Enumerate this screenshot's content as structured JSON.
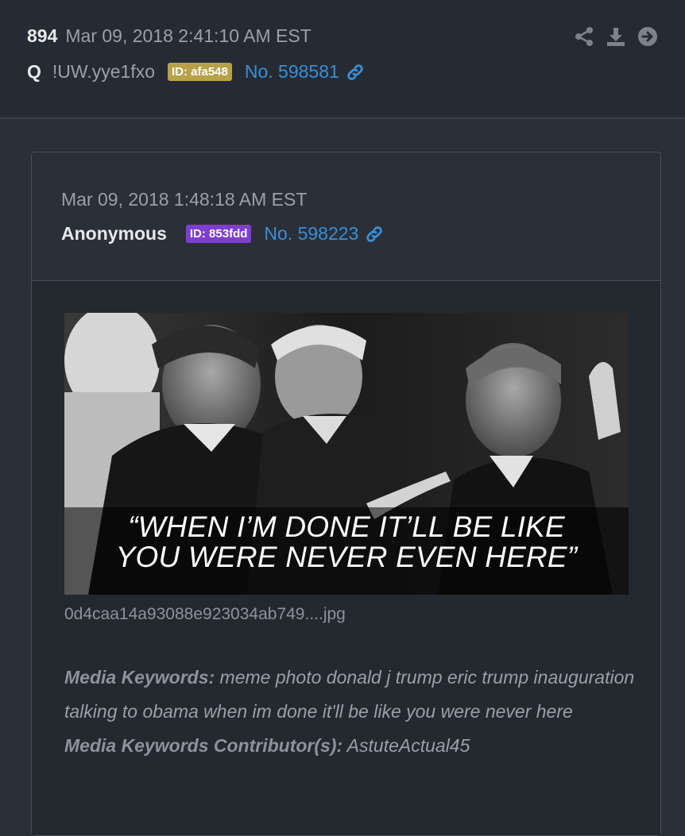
{
  "post": {
    "number": "894",
    "timestamp": "Mar 09, 2018 2:41:10 AM EST",
    "author": "Q",
    "tripcode": "!UW.yye1fxo",
    "id_badge": "ID: afa548",
    "id_color": "#b7a24a",
    "post_no": "No. 598581",
    "actions": [
      "share-icon",
      "download-icon",
      "arrow-right-circle-icon"
    ]
  },
  "quoted": {
    "timestamp": "Mar 09, 2018 1:48:18 AM EST",
    "author": "Anonymous",
    "id_badge": "ID: 853fdd",
    "id_color": "#7e3fd0",
    "post_no": "No. 598223",
    "image": {
      "caption_line1": "“WHEN I’M DONE IT’LL BE LIKE",
      "caption_line2": "YOU WERE NEVER EVEN HERE”"
    },
    "filename": "0d4caa14a93088e923034ab749....jpg",
    "keywords_label": "Media Keywords:",
    "keywords": "meme photo donald j trump eric trump inauguration talking to obama when im done it'll be like you were never here",
    "contributors_label": "Media Keywords Contributor(s):",
    "contributors": "AstuteActual45"
  },
  "colors": {
    "link": "#3a8fd6",
    "background": "#2a2f38"
  }
}
